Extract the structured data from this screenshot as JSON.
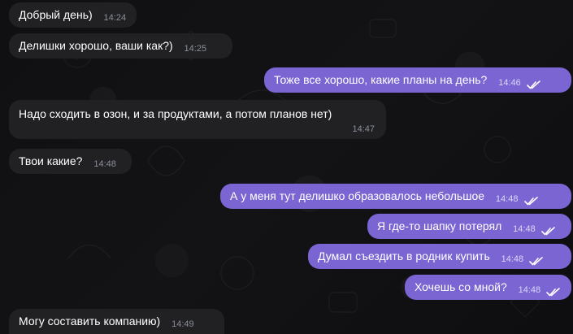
{
  "messages": [
    {
      "direction": "incoming",
      "text": "Добрый день)",
      "time": "14:24"
    },
    {
      "direction": "incoming",
      "text": "Делишки хорошо, ваши как?)",
      "time": "14:25"
    },
    {
      "direction": "outgoing",
      "text": "Тоже все хорошо, какие планы на день?",
      "time": "14:46",
      "status_icon": "double-check-icon"
    },
    {
      "direction": "incoming",
      "text": "Надо сходить в озон, и за продуктами, а потом планов нет)",
      "time": "14:47"
    },
    {
      "direction": "incoming",
      "text": "Твои какие?",
      "time": "14:48"
    },
    {
      "direction": "outgoing",
      "text": "А у меня тут делишко образовалось небольшое",
      "time": "14:48",
      "status_icon": "double-check-icon"
    },
    {
      "direction": "outgoing",
      "text": "Я где-то шапку потерял",
      "time": "14:48",
      "status_icon": "double-check-icon"
    },
    {
      "direction": "outgoing",
      "text": "Думал съездить в родник купить",
      "time": "14:48",
      "status_icon": "double-check-icon"
    },
    {
      "direction": "outgoing",
      "text": "Хочешь со мной?",
      "time": "14:48",
      "status_icon": "double-check-icon"
    },
    {
      "direction": "incoming",
      "text": "Могу составить компанию)",
      "time": "14:49"
    }
  ],
  "colors": {
    "background": "#0f0f10",
    "incoming_bubble": "#212124",
    "outgoing_bubble": "#7a65d2",
    "text": "#ffffff",
    "incoming_time": "#8b8f9b",
    "outgoing_time": "#ddd7fb"
  }
}
